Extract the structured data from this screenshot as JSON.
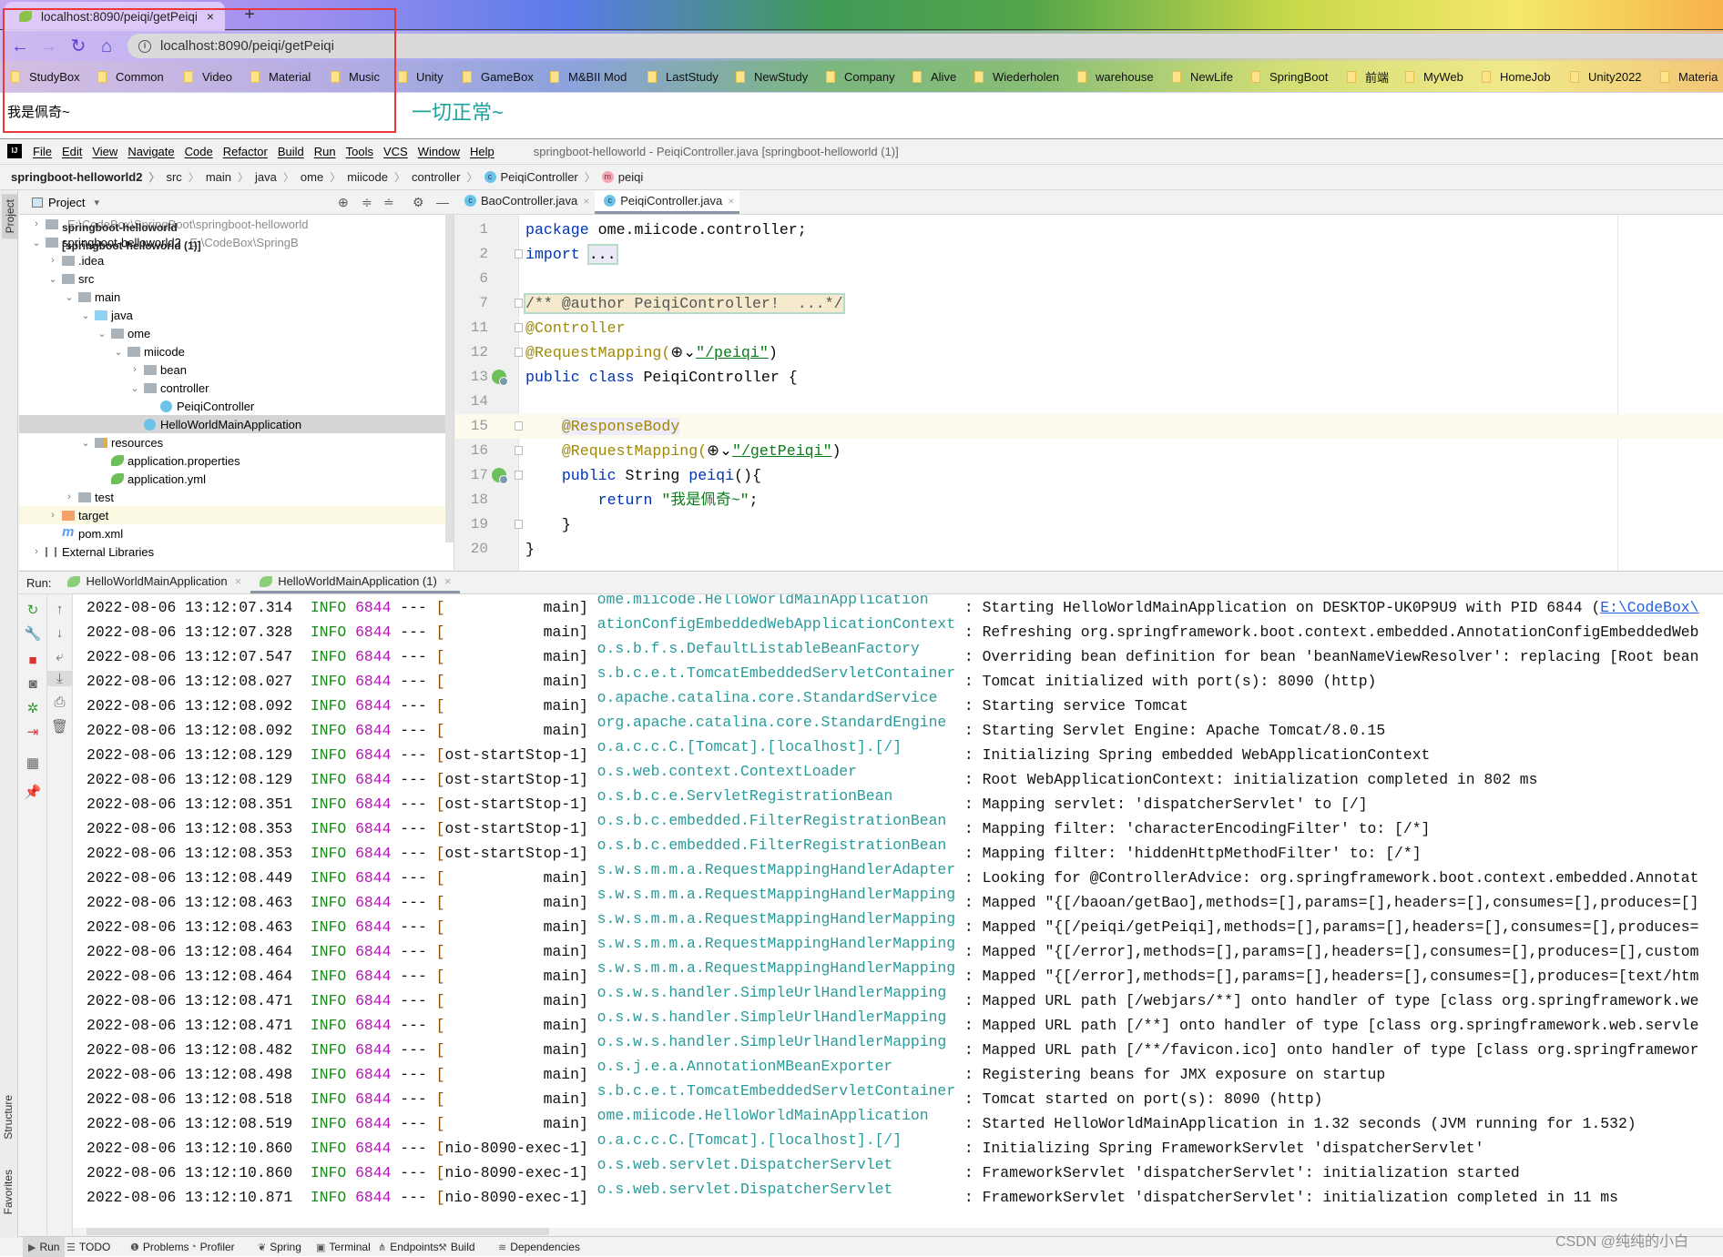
{
  "browser": {
    "tab_title": "localhost:8090/peiqi/getPeiqi",
    "tab_close": "×",
    "new_tab": "+",
    "nav": {
      "back": "←",
      "forward": "→",
      "reload": "↻",
      "home": "⌂"
    },
    "url": "localhost:8090/peiqi/getPeiqi",
    "info_icon": "i",
    "bookmarks": [
      "StudyBox",
      "Common",
      "Video",
      "Material",
      "Music",
      "Unity",
      "GameBox",
      "M&BII Mod",
      "LastStudy",
      "NewStudy",
      "Company",
      "Alive",
      "Wiederholen",
      "warehouse",
      "NewLife",
      "SpringBoot",
      "前端",
      "MyWeb",
      "HomeJob",
      "Unity2022",
      "Materia"
    ],
    "page_text": "我是佩奇~",
    "annotation_box_color": "#e8383d"
  },
  "annotation_text": "一切正常~",
  "ide": {
    "logo": "IJ",
    "menu": [
      "File",
      "Edit",
      "View",
      "Navigate",
      "Code",
      "Refactor",
      "Build",
      "Run",
      "Tools",
      "VCS",
      "Window",
      "Help"
    ],
    "window_title": "springboot-helloworld - PeiqiController.java [springboot-helloworld (1)]",
    "breadcrumbs": [
      "springboot-helloworld2",
      "src",
      "main",
      "java",
      "ome",
      "miicode",
      "controller",
      "PeiqiController",
      "peiqi"
    ],
    "left_strip": {
      "project": "Project",
      "structure": "Structure",
      "favorites": "Favorites"
    },
    "project_panel": {
      "title": "Project",
      "dropdown": "▾",
      "tree": [
        {
          "label": "springboot-helloworld",
          "bold": true,
          "path": "E:\\CodeBox\\SpringBoot\\springboot-helloworld",
          "depth": 0,
          "expand": "collapsed",
          "icon": "module"
        },
        {
          "label": "springboot-helloworld2 ",
          "bold_suffix": "[springboot-helloworld (1)]",
          "path": "E:\\CodeBox\\SpringB",
          "depth": 0,
          "expand": "expanded",
          "icon": "module"
        },
        {
          "label": ".idea",
          "depth": 1,
          "expand": "collapsed",
          "icon": "folder"
        },
        {
          "label": "src",
          "depth": 1,
          "expand": "expanded",
          "icon": "folder"
        },
        {
          "label": "main",
          "depth": 2,
          "expand": "expanded",
          "icon": "folder"
        },
        {
          "label": "java",
          "depth": 3,
          "expand": "expanded",
          "icon": "source-folder"
        },
        {
          "label": "ome",
          "depth": 4,
          "expand": "expanded",
          "icon": "package"
        },
        {
          "label": "miicode",
          "depth": 5,
          "expand": "expanded",
          "icon": "package"
        },
        {
          "label": "bean",
          "depth": 6,
          "expand": "collapsed",
          "icon": "package"
        },
        {
          "label": "controller",
          "depth": 6,
          "expand": "expanded",
          "icon": "package"
        },
        {
          "label": "PeiqiController",
          "depth": 7,
          "icon": "class"
        },
        {
          "label": "HelloWorldMainApplication",
          "depth": 6,
          "icon": "spring-boot-class",
          "selected": true
        },
        {
          "label": "resources",
          "depth": 3,
          "expand": "expanded",
          "icon": "resources-folder"
        },
        {
          "label": "application.properties",
          "depth": 4,
          "icon": "spring-config"
        },
        {
          "label": "application.yml",
          "depth": 4,
          "icon": "spring-config"
        },
        {
          "label": "test",
          "depth": 2,
          "expand": "collapsed",
          "icon": "folder"
        },
        {
          "label": "target",
          "depth": 1,
          "expand": "collapsed",
          "icon": "excluded-folder",
          "ignored": true
        },
        {
          "label": "pom.xml",
          "depth": 1,
          "icon": "maven"
        },
        {
          "label": "External Libraries",
          "depth": 0,
          "expand": "collapsed",
          "icon": "libraries"
        }
      ]
    },
    "editor": {
      "tabs": [
        {
          "label": "BaoController.java",
          "active": false
        },
        {
          "label": "PeiqiController.java",
          "active": true
        }
      ],
      "current_line": "15",
      "lines": [
        {
          "num": "1",
          "tokens": [
            {
              "t": "package",
              "c": "kw"
            },
            {
              "t": " ome.miicode.controller;",
              "c": "plain"
            }
          ]
        },
        {
          "num": "2",
          "fold": true,
          "tokens": [
            {
              "t": "import",
              "c": "kw"
            },
            {
              "t": " ",
              "c": "plain"
            },
            {
              "t": "...",
              "c": "fold"
            }
          ]
        },
        {
          "num": "6",
          "tokens": []
        },
        {
          "num": "7",
          "fold": true,
          "tokens": [
            {
              "t": "/** @author PeiqiController!  ...*/",
              "c": "cmt"
            }
          ]
        },
        {
          "num": "11",
          "fold": true,
          "tokens": [
            {
              "t": "@Controller",
              "c": "ann"
            }
          ]
        },
        {
          "num": "12",
          "fold": true,
          "tokens": [
            {
              "t": "@RequestMapping(",
              "c": "ann"
            },
            {
              "t": "⊕⌄",
              "c": "plain"
            },
            {
              "t": "\"/peiqi\"",
              "c": "str"
            },
            {
              "t": ")",
              "c": "plain"
            }
          ]
        },
        {
          "num": "13",
          "gutter_icon": "spring-bean",
          "tokens": [
            {
              "t": "public class",
              "c": "kw"
            },
            {
              "t": " PeiqiController {",
              "c": "plain"
            }
          ]
        },
        {
          "num": "14",
          "tokens": []
        },
        {
          "num": "15",
          "fold": true,
          "tokens": [
            {
              "t": "    ",
              "c": "plain"
            },
            {
              "t": "@ResponseBody",
              "c": "ann anb"
            }
          ]
        },
        {
          "num": "16",
          "fold": true,
          "tokens": [
            {
              "t": "    @RequestMapping(",
              "c": "ann"
            },
            {
              "t": "⊕⌄",
              "c": "plain"
            },
            {
              "t": "\"/getPeiqi\"",
              "c": "str"
            },
            {
              "t": ")",
              "c": "plain"
            }
          ]
        },
        {
          "num": "17",
          "gutter_icon": "spring-web",
          "fold": true,
          "tokens": [
            {
              "t": "    ",
              "c": "plain"
            },
            {
              "t": "public",
              "c": "kw"
            },
            {
              "t": " String ",
              "c": "plain"
            },
            {
              "t": "peiqi",
              "c": "kw"
            },
            {
              "t": "(){",
              "c": "plain"
            }
          ]
        },
        {
          "num": "18",
          "tokens": [
            {
              "t": "        ",
              "c": "plain"
            },
            {
              "t": "return",
              "c": "kw"
            },
            {
              "t": " ",
              "c": "plain"
            },
            {
              "t": "\"我是佩奇~\"",
              "c": "str"
            },
            {
              "t": ";",
              "c": "plain"
            }
          ]
        },
        {
          "num": "19",
          "fold": true,
          "tokens": [
            {
              "t": "    }",
              "c": "plain"
            }
          ]
        },
        {
          "num": "20",
          "tokens": [
            {
              "t": "}",
              "c": "plain"
            }
          ]
        }
      ]
    },
    "run": {
      "label": "Run:",
      "tabs": [
        {
          "label": "HelloWorldMainApplication",
          "active": false
        },
        {
          "label": "HelloWorldMainApplication (1)",
          "active": true
        }
      ],
      "close": "×",
      "separator": "---",
      "colon": ":",
      "lines": [
        {
          "time": "2022-08-06 13:12:07.314",
          "level": "INFO",
          "pid": "6844",
          "thread": "main",
          "logger": "ome.miicode.HelloWorldMainApplication",
          "msg": "Starting HelloWorldMainApplication on DESKTOP-UK0P9U9 with PID 6844 (",
          "link": "E:\\CodeBox\\"
        },
        {
          "time": "2022-08-06 13:12:07.328",
          "level": "INFO",
          "pid": "6844",
          "thread": "main",
          "logger": "ationConfigEmbeddedWebApplicationContext",
          "msg": "Refreshing org.springframework.boot.context.embedded.AnnotationConfigEmbeddedWeb"
        },
        {
          "time": "2022-08-06 13:12:07.547",
          "level": "INFO",
          "pid": "6844",
          "thread": "main",
          "logger": "o.s.b.f.s.DefaultListableBeanFactory",
          "msg": "Overriding bean definition for bean 'beanNameViewResolver': replacing [Root bean"
        },
        {
          "time": "2022-08-06 13:12:08.027",
          "level": "INFO",
          "pid": "6844",
          "thread": "main",
          "logger": "s.b.c.e.t.TomcatEmbeddedServletContainer",
          "msg": "Tomcat initialized with port(s): 8090 (http)"
        },
        {
          "time": "2022-08-06 13:12:08.092",
          "level": "INFO",
          "pid": "6844",
          "thread": "main",
          "logger": "o.apache.catalina.core.StandardService",
          "msg": "Starting service Tomcat"
        },
        {
          "time": "2022-08-06 13:12:08.092",
          "level": "INFO",
          "pid": "6844",
          "thread": "main",
          "logger": "org.apache.catalina.core.StandardEngine",
          "msg": "Starting Servlet Engine: Apache Tomcat/8.0.15"
        },
        {
          "time": "2022-08-06 13:12:08.129",
          "level": "INFO",
          "pid": "6844",
          "thread": "ost-startStop-1",
          "logger": "o.a.c.c.C.[Tomcat].[localhost].[/]",
          "msg": "Initializing Spring embedded WebApplicationContext"
        },
        {
          "time": "2022-08-06 13:12:08.129",
          "level": "INFO",
          "pid": "6844",
          "thread": "ost-startStop-1",
          "logger": "o.s.web.context.ContextLoader",
          "msg": "Root WebApplicationContext: initialization completed in 802 ms"
        },
        {
          "time": "2022-08-06 13:12:08.351",
          "level": "INFO",
          "pid": "6844",
          "thread": "ost-startStop-1",
          "logger": "o.s.b.c.e.ServletRegistrationBean",
          "msg": "Mapping servlet: 'dispatcherServlet' to [/]"
        },
        {
          "time": "2022-08-06 13:12:08.353",
          "level": "INFO",
          "pid": "6844",
          "thread": "ost-startStop-1",
          "logger": "o.s.b.c.embedded.FilterRegistrationBean",
          "msg": "Mapping filter: 'characterEncodingFilter' to: [/*]"
        },
        {
          "time": "2022-08-06 13:12:08.353",
          "level": "INFO",
          "pid": "6844",
          "thread": "ost-startStop-1",
          "logger": "o.s.b.c.embedded.FilterRegistrationBean",
          "msg": "Mapping filter: 'hiddenHttpMethodFilter' to: [/*]"
        },
        {
          "time": "2022-08-06 13:12:08.449",
          "level": "INFO",
          "pid": "6844",
          "thread": "main",
          "logger": "s.w.s.m.m.a.RequestMappingHandlerAdapter",
          "msg": "Looking for @ControllerAdvice: org.springframework.boot.context.embedded.Annotat"
        },
        {
          "time": "2022-08-06 13:12:08.463",
          "level": "INFO",
          "pid": "6844",
          "thread": "main",
          "logger": "s.w.s.m.m.a.RequestMappingHandlerMapping",
          "msg": "Mapped \"{[/baoan/getBao],methods=[],params=[],headers=[],consumes=[],produces=[]"
        },
        {
          "time": "2022-08-06 13:12:08.463",
          "level": "INFO",
          "pid": "6844",
          "thread": "main",
          "logger": "s.w.s.m.m.a.RequestMappingHandlerMapping",
          "msg": "Mapped \"{[/peiqi/getPeiqi],methods=[],params=[],headers=[],consumes=[],produces="
        },
        {
          "time": "2022-08-06 13:12:08.464",
          "level": "INFO",
          "pid": "6844",
          "thread": "main",
          "logger": "s.w.s.m.m.a.RequestMappingHandlerMapping",
          "msg": "Mapped \"{[/error],methods=[],params=[],headers=[],consumes=[],produces=[],custom"
        },
        {
          "time": "2022-08-06 13:12:08.464",
          "level": "INFO",
          "pid": "6844",
          "thread": "main",
          "logger": "s.w.s.m.m.a.RequestMappingHandlerMapping",
          "msg": "Mapped \"{[/error],methods=[],params=[],headers=[],consumes=[],produces=[text/htm"
        },
        {
          "time": "2022-08-06 13:12:08.471",
          "level": "INFO",
          "pid": "6844",
          "thread": "main",
          "logger": "o.s.w.s.handler.SimpleUrlHandlerMapping",
          "msg": "Mapped URL path [/webjars/**] onto handler of type [class org.springframework.we"
        },
        {
          "time": "2022-08-06 13:12:08.471",
          "level": "INFO",
          "pid": "6844",
          "thread": "main",
          "logger": "o.s.w.s.handler.SimpleUrlHandlerMapping",
          "msg": "Mapped URL path [/**] onto handler of type [class org.springframework.web.servle"
        },
        {
          "time": "2022-08-06 13:12:08.482",
          "level": "INFO",
          "pid": "6844",
          "thread": "main",
          "logger": "o.s.w.s.handler.SimpleUrlHandlerMapping",
          "msg": "Mapped URL path [/**/favicon.ico] onto handler of type [class org.springframewor"
        },
        {
          "time": "2022-08-06 13:12:08.498",
          "level": "INFO",
          "pid": "6844",
          "thread": "main",
          "logger": "o.s.j.e.a.AnnotationMBeanExporter",
          "msg": "Registering beans for JMX exposure on startup"
        },
        {
          "time": "2022-08-06 13:12:08.518",
          "level": "INFO",
          "pid": "6844",
          "thread": "main",
          "logger": "s.b.c.e.t.TomcatEmbeddedServletContainer",
          "msg": "Tomcat started on port(s): 8090 (http)"
        },
        {
          "time": "2022-08-06 13:12:08.519",
          "level": "INFO",
          "pid": "6844",
          "thread": "main",
          "logger": "ome.miicode.HelloWorldMainApplication",
          "msg": "Started HelloWorldMainApplication in 1.32 seconds (JVM running for 1.532)"
        },
        {
          "time": "2022-08-06 13:12:10.860",
          "level": "INFO",
          "pid": "6844",
          "thread": "nio-8090-exec-1",
          "logger": "o.a.c.c.C.[Tomcat].[localhost].[/]",
          "msg": "Initializing Spring FrameworkServlet 'dispatcherServlet'"
        },
        {
          "time": "2022-08-06 13:12:10.860",
          "level": "INFO",
          "pid": "6844",
          "thread": "nio-8090-exec-1",
          "logger": "o.s.web.servlet.DispatcherServlet",
          "msg": "FrameworkServlet 'dispatcherServlet': initialization started"
        },
        {
          "time": "2022-08-06 13:12:10.871",
          "level": "INFO",
          "pid": "6844",
          "thread": "nio-8090-exec-1",
          "logger": "o.s.web.servlet.DispatcherServlet",
          "msg": "FrameworkServlet 'dispatcherServlet': initialization completed in 11 ms"
        }
      ]
    },
    "bottom_tools": [
      {
        "label": "Run",
        "icon": "▶",
        "active": true
      },
      {
        "label": "TODO",
        "icon": "☰"
      },
      {
        "label": "Problems",
        "icon": "❶"
      },
      {
        "label": "Profiler",
        "icon": "◔"
      },
      {
        "label": "Spring",
        "icon": "❦"
      },
      {
        "label": "Terminal",
        "icon": "▣"
      },
      {
        "label": "Endpoints",
        "icon": "⋔"
      },
      {
        "label": "Build",
        "icon": "⚒"
      },
      {
        "label": "Dependencies",
        "icon": "≋"
      }
    ]
  },
  "watermark": "CSDN @纯纯的小白"
}
